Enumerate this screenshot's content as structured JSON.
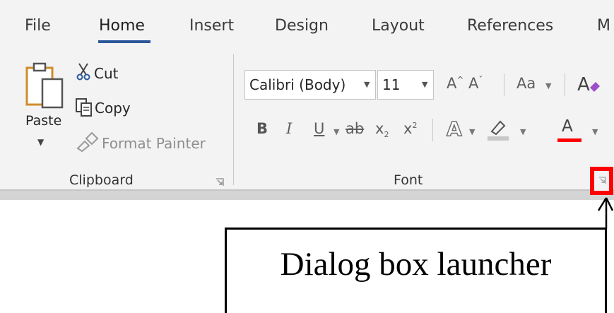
{
  "tabs": [
    "File",
    "Home",
    "Insert",
    "Design",
    "Layout",
    "References",
    "M"
  ],
  "active_tab": "Home",
  "clipboard": {
    "paste_label": "Paste",
    "cut_label": "Cut",
    "copy_label": "Copy",
    "format_painter_label": "Format Painter",
    "group_label": "Clipboard"
  },
  "font": {
    "font_name": "Calibri (Body)",
    "font_size": "11",
    "group_label": "Font",
    "change_case_label": "Aa",
    "bold": "B",
    "italic": "I",
    "underline": "U",
    "strikethrough": "ab",
    "subscript": "x",
    "subscript_mark": "2",
    "superscript": "x",
    "superscript_mark": "2",
    "text_effects": "A",
    "font_color": "A",
    "grow_font": "A",
    "shrink_font": "A"
  },
  "colors": {
    "accent": "#2b579a",
    "highlight_box": "#ff0000",
    "font_color_underline": "#ff0000",
    "highlighter": "#c8c8c8"
  },
  "annotation": {
    "text": "Dialog box launcher"
  }
}
